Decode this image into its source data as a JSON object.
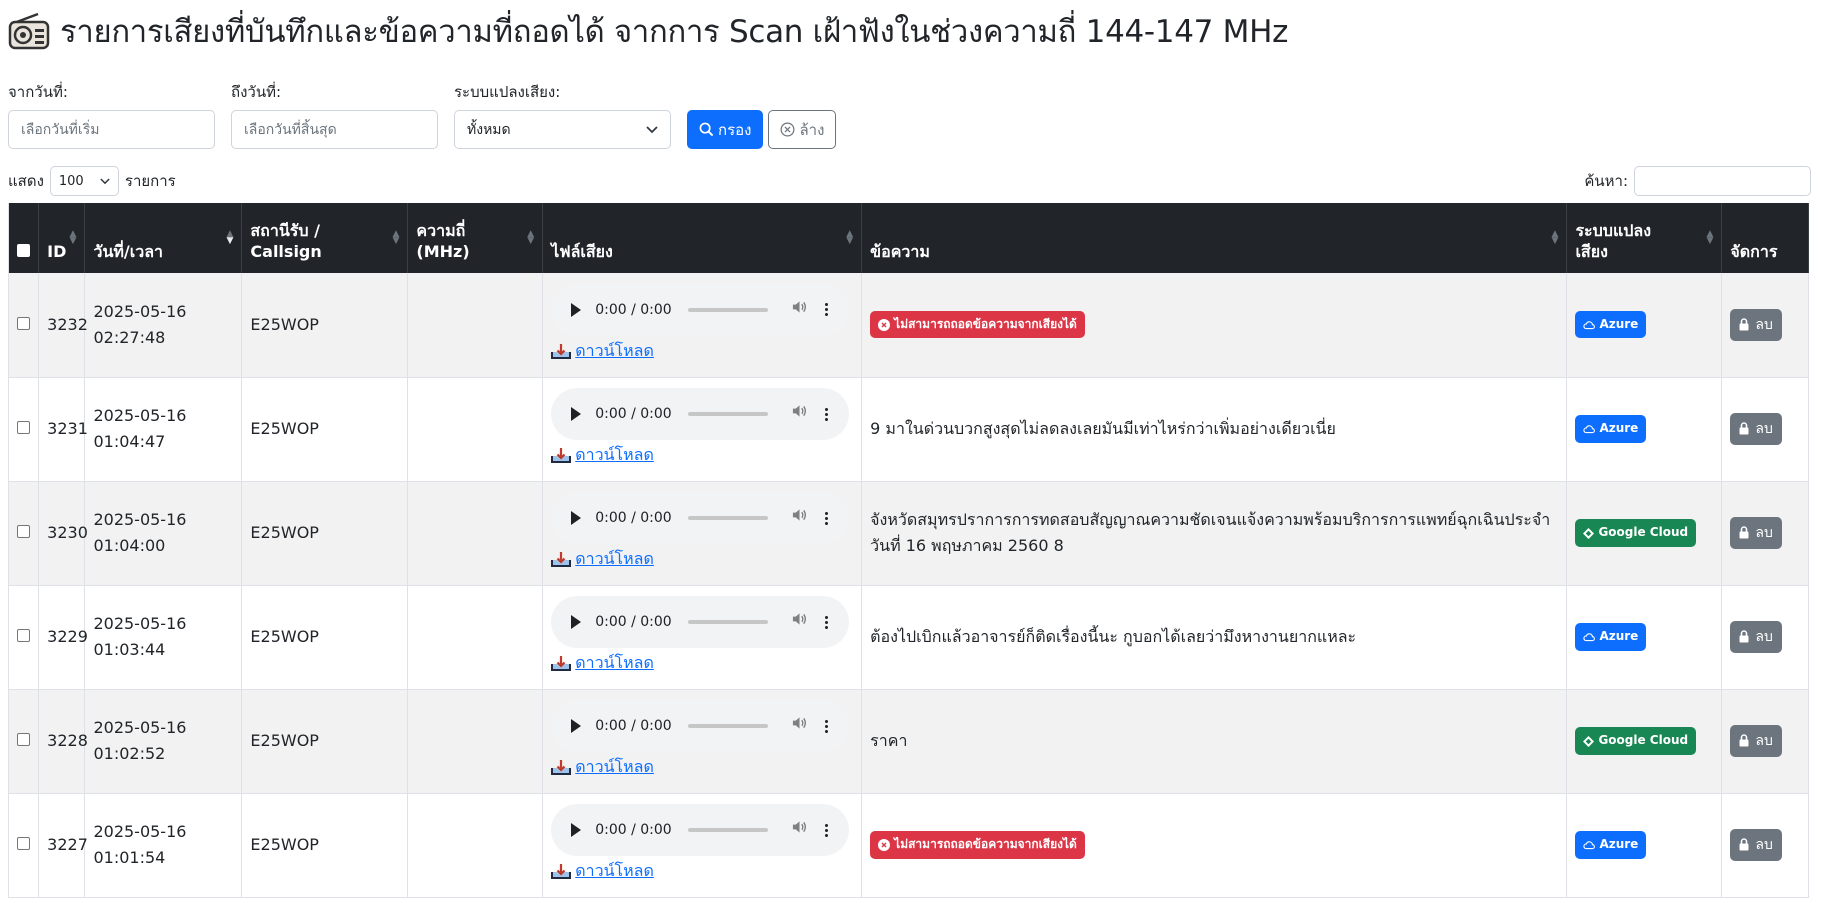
{
  "page": {
    "title": "รายการเสียงที่บันทึกและข้อความที่ถอดได้ จากการ Scan เฝ้าฟังในช่วงความถี่ 144-147 MHz"
  },
  "filters": {
    "from_label": "จากวันที่:",
    "from_placeholder": "เลือกวันที่เริ่ม",
    "to_label": "ถึงวันที่:",
    "to_placeholder": "เลือกวันที่สิ้นสุด",
    "engine_label": "ระบบแปลงเสียง:",
    "engine_value": "ทั้งหมด",
    "filter_button": "กรอง",
    "clear_button": "ล้าง"
  },
  "table_controls": {
    "show_label": "แสดง",
    "page_length": "100",
    "entries_label": "รายการ",
    "search_label": "ค้นหา:"
  },
  "columns": {
    "id": "ID",
    "datetime": "วันที่/เวลา",
    "station_line1": "สถานีรับ /",
    "station_line2": "Callsign",
    "freq_line1": "ความถี่",
    "freq_line2": "(MHz)",
    "audio": "ไฟล์เสียง",
    "message": "ข้อความ",
    "engine_line1": "ระบบแปลง",
    "engine_line2": "เสียง",
    "actions": "จัดการ"
  },
  "audio_player": {
    "time": "0:00 / 0:00"
  },
  "labels": {
    "download": "ดาวน์โหลด",
    "delete": "ลบ",
    "error_badge": "ไม่สามารถถอดข้อความจากเสียงได้"
  },
  "rows": [
    {
      "id": "3232",
      "date": "2025-05-16",
      "time": "02:27:48",
      "callsign": "E25WOP",
      "freq": "",
      "message": "",
      "error": true,
      "engine": "Azure"
    },
    {
      "id": "3231",
      "date": "2025-05-16",
      "time": "01:04:47",
      "callsign": "E25WOP",
      "freq": "",
      "message": "9 มาในด่วนบวกสูงสุดไม่ลดลงเลยมันมีเท่าไหร่กว่าเพิ่มอย่างเดียวเนี่ย",
      "error": false,
      "engine": "Azure"
    },
    {
      "id": "3230",
      "date": "2025-05-16",
      "time": "01:04:00",
      "callsign": "E25WOP",
      "freq": "",
      "message": "จังหวัดสมุทรปราการการทดสอบสัญญาณความชัดเจนแจ้งความพร้อมบริการการแพทย์ฉุกเฉินประจำวันที่ 16 พฤษภาคม 2560 8",
      "error": false,
      "engine": "Google Cloud"
    },
    {
      "id": "3229",
      "date": "2025-05-16",
      "time": "01:03:44",
      "callsign": "E25WOP",
      "freq": "",
      "message": "ต้องไปเบิกแล้วอาจารย์ก็ติดเรื่องนี้นะ กูบอกได้เลยว่ามึงหางานยากแหละ",
      "error": false,
      "engine": "Azure"
    },
    {
      "id": "3228",
      "date": "2025-05-16",
      "time": "01:02:52",
      "callsign": "E25WOP",
      "freq": "",
      "message": "ราคา",
      "error": false,
      "engine": "Google Cloud"
    },
    {
      "id": "3227",
      "date": "2025-05-16",
      "time": "01:01:54",
      "callsign": "E25WOP",
      "freq": "",
      "message": "",
      "error": true,
      "engine": "Azure"
    }
  ],
  "colors": {
    "primary": "#0d6efd",
    "danger": "#dc3545",
    "success": "#198754",
    "secondary": "#6c757d",
    "header_bg": "#212529"
  }
}
